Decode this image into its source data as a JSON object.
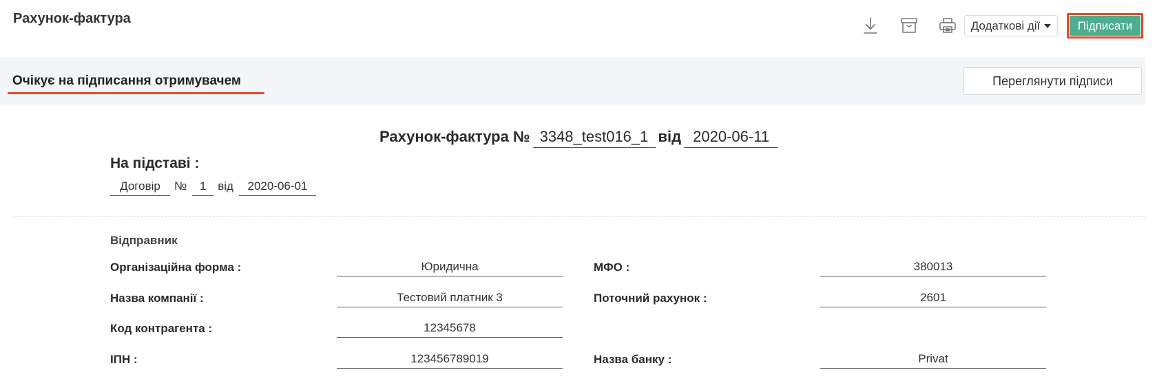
{
  "header": {
    "title": "Рахунок-фактура",
    "more_actions_label": "Додаткові дії",
    "sign_label": "Підписати",
    "icons": [
      "download-icon",
      "archive-icon",
      "print-icon"
    ]
  },
  "status": {
    "text": "Очікує на підписання отримувачем",
    "view_signatures_label": "Переглянути підписи"
  },
  "document": {
    "title_prefix": "Рахунок-фактура №",
    "number": "3348_test016_1",
    "date_word": "від",
    "date": "2020-06-11"
  },
  "basis": {
    "title": "На підставі :",
    "type": "Договір",
    "number_sign": "№",
    "number": "1",
    "date_word": "від",
    "date": "2020-06-01"
  },
  "sender": {
    "label": "Відправник",
    "org_form_label": "Організаційна форма :",
    "org_form_value": "Юридична",
    "company_name_label": "Назва компанії :",
    "company_name_value": "Тестовий платник 3",
    "counterparty_code_label": "Код контрагента :",
    "counterparty_code_value": "12345678",
    "ipn_label": "ІПН :",
    "ipn_value": "123456789019",
    "mfo_label": "МФО :",
    "mfo_value": "380013",
    "account_label": "Поточний рахунок :",
    "account_value": "2601",
    "bank_label": "Назва банку :",
    "bank_value": "Privat"
  },
  "colors": {
    "accent_green": "#4cae8f",
    "highlight_red": "#e8472c",
    "status_bg": "#f3f6f9"
  }
}
